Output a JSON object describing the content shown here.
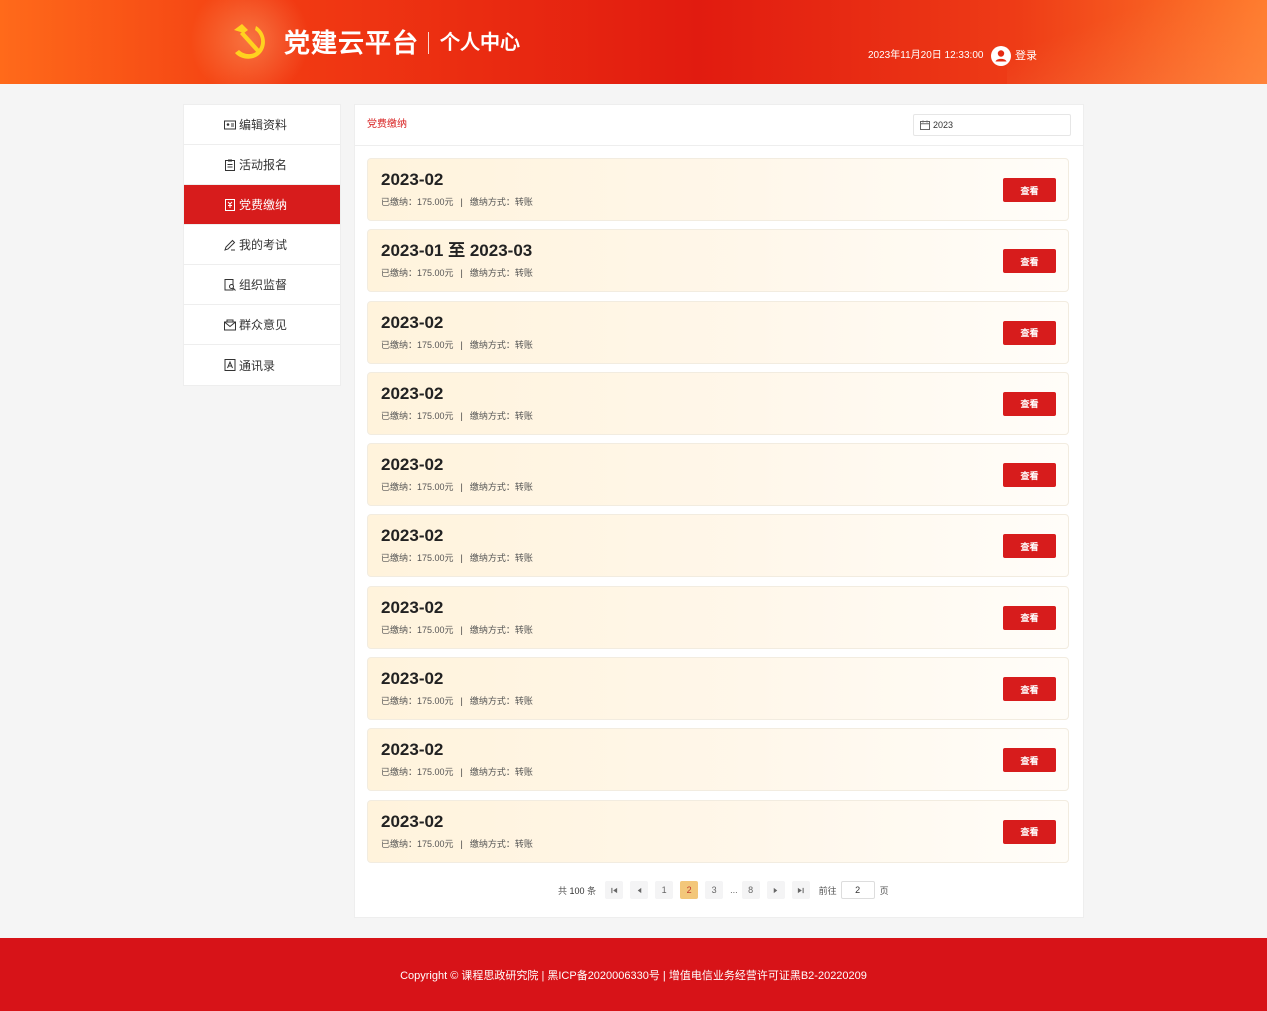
{
  "header": {
    "brand": "党建云平台",
    "sub_brand": "个人中心",
    "datetime": "2023年11月20日 12:33:00",
    "login_label": "登录",
    "logo_icon": "hammer-sickle-icon",
    "user_icon": "user-circle-icon"
  },
  "sidebar": {
    "items": [
      {
        "label": "编辑资料",
        "icon": "id-card-icon",
        "active": false
      },
      {
        "label": "活动报名",
        "icon": "clipboard-icon",
        "active": false
      },
      {
        "label": "党费缴纳",
        "icon": "receipt-icon",
        "active": true
      },
      {
        "label": "我的考试",
        "icon": "pen-icon",
        "active": false
      },
      {
        "label": "组织监督",
        "icon": "document-search-icon",
        "active": false
      },
      {
        "label": "群众意见",
        "icon": "mail-icon",
        "active": false
      },
      {
        "label": "通讯录",
        "icon": "contacts-icon",
        "active": false
      }
    ]
  },
  "main": {
    "crumb": "党费缴纳",
    "year_filter": "2023",
    "records": [
      {
        "period": "2023-02",
        "paid_label": "已缴纳：",
        "amount": "175.00元",
        "separator": "|",
        "method_label": "缴纳方式：",
        "method": "转账",
        "button": "查看"
      },
      {
        "period": "2023-01 至 2023-03",
        "paid_label": "已缴纳：",
        "amount": "175.00元",
        "separator": "|",
        "method_label": "缴纳方式：",
        "method": "转账",
        "button": "查看"
      },
      {
        "period": "2023-02",
        "paid_label": "已缴纳：",
        "amount": "175.00元",
        "separator": "|",
        "method_label": "缴纳方式：",
        "method": "转账",
        "button": "查看"
      },
      {
        "period": "2023-02",
        "paid_label": "已缴纳：",
        "amount": "175.00元",
        "separator": "|",
        "method_label": "缴纳方式：",
        "method": "转账",
        "button": "查看"
      },
      {
        "period": "2023-02",
        "paid_label": "已缴纳：",
        "amount": "175.00元",
        "separator": "|",
        "method_label": "缴纳方式：",
        "method": "转账",
        "button": "查看"
      },
      {
        "period": "2023-02",
        "paid_label": "已缴纳：",
        "amount": "175.00元",
        "separator": "|",
        "method_label": "缴纳方式：",
        "method": "转账",
        "button": "查看"
      },
      {
        "period": "2023-02",
        "paid_label": "已缴纳：",
        "amount": "175.00元",
        "separator": "|",
        "method_label": "缴纳方式：",
        "method": "转账",
        "button": "查看"
      },
      {
        "period": "2023-02",
        "paid_label": "已缴纳：",
        "amount": "175.00元",
        "separator": "|",
        "method_label": "缴纳方式：",
        "method": "转账",
        "button": "查看"
      },
      {
        "period": "2023-02",
        "paid_label": "已缴纳：",
        "amount": "175.00元",
        "separator": "|",
        "method_label": "缴纳方式：",
        "method": "转账",
        "button": "查看"
      },
      {
        "period": "2023-02",
        "paid_label": "已缴纳：",
        "amount": "175.00元",
        "separator": "|",
        "method_label": "缴纳方式：",
        "method": "转账",
        "button": "查看"
      }
    ]
  },
  "pagination": {
    "total_prefix": "共",
    "total": "100",
    "total_suffix": "条",
    "pages": [
      "1",
      "2",
      "3",
      "8"
    ],
    "current": "2",
    "ellipsis": "...",
    "goto_label": "前往",
    "goto_value": "2",
    "goto_suffix": "页"
  },
  "footer": {
    "text": "Copyright © 课程思政研究院 | 黑ICP备2020006330号 | 增值电信业务经营许可证黑B2-20220209"
  },
  "colors": {
    "primary_red": "#d71c1c",
    "record_bg": "#fff3dc",
    "active_page": "#f3c77a"
  }
}
